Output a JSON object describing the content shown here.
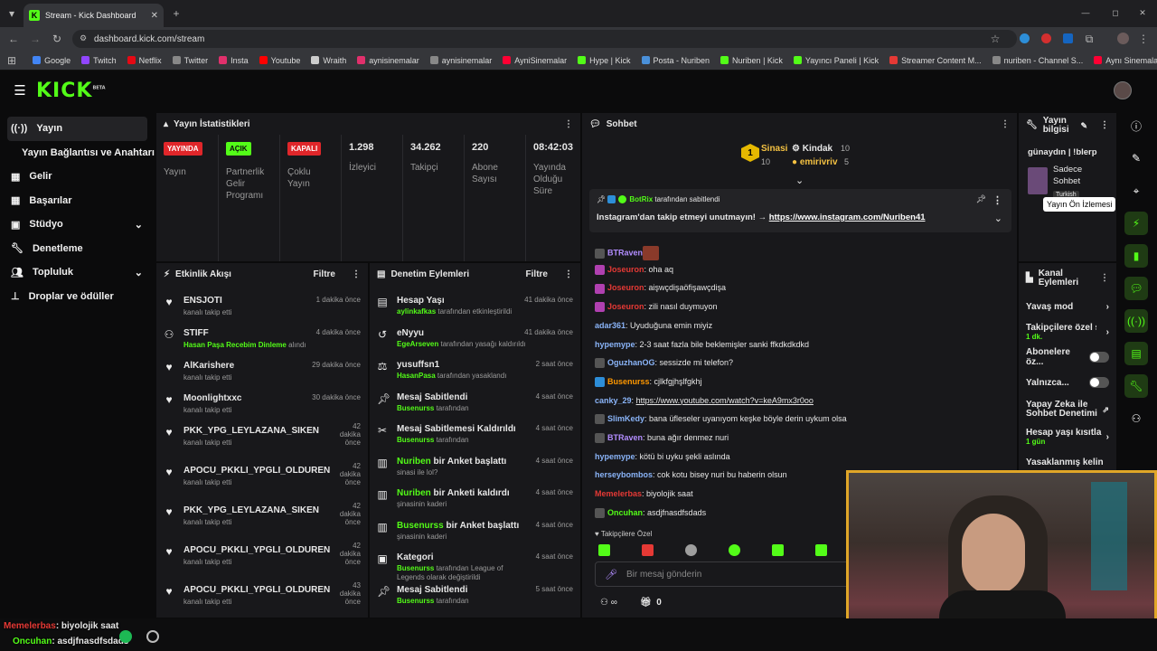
{
  "browser": {
    "tab_title": "Stream - Kick Dashboard",
    "url": "dashboard.kick.com/stream",
    "bookmarks": [
      "Google",
      "Twitch",
      "Netflix",
      "Twitter",
      "Insta",
      "Youtube",
      "Wraith",
      "aynisinemalar",
      "aynisinemalar",
      "AyniSinemalar",
      "Hype | Kick",
      "Posta - Nuriben",
      "Nuriben | Kick",
      "Yayıncı Paneli | Kick",
      "Streamer Content M...",
      "nuriben - Channel S...",
      "Aynı Sinemalar - Ça..."
    ]
  },
  "logo": "KICK",
  "logo_sup": "BETA",
  "sidebar": {
    "items": [
      {
        "label": "Yayın"
      },
      {
        "label": "Yayın Bağlantısı ve Anahtarı"
      },
      {
        "label": "Gelir"
      },
      {
        "label": "Başarılar"
      },
      {
        "label": "Stüdyo"
      },
      {
        "label": "Denetleme"
      },
      {
        "label": "Topluluk"
      },
      {
        "label": "Droplar ve ödüller"
      }
    ]
  },
  "stats": {
    "title": "Yayın İstatistikleri",
    "cards": [
      {
        "badge": "YAYINDA",
        "label": "Yayın"
      },
      {
        "badge": "AÇIK",
        "label": "Partnerlik Gelir Programı"
      },
      {
        "badge": "KAPALI",
        "label": "Çoklu Yayın"
      },
      {
        "value": "1.298",
        "label": "İzleyici"
      },
      {
        "value": "34.262",
        "label": "Takipçi"
      },
      {
        "value": "220",
        "label": "Abone Sayısı"
      },
      {
        "value": "08:42:03",
        "label": "Yayında Olduğu Süre"
      }
    ]
  },
  "activity": {
    "title": "Etkinlik Akışı",
    "filter": "Filtre",
    "items": [
      {
        "name": "ENSJOTI",
        "sub": "kanalı takip etti",
        "time": "1 dakika önce"
      },
      {
        "name": "STIFF",
        "sub_highlight": "Hasan Paşa Recebim Dinleme",
        "sub": " alındı",
        "time": "4 dakika önce"
      },
      {
        "name": "AlKarishere",
        "sub": "kanalı takip etti",
        "time": "29 dakika önce"
      },
      {
        "name": "Moonlightxxc",
        "sub": "kanalı takip etti",
        "time": "30 dakika önce"
      },
      {
        "name": "PKK_YPG_LEYLAZANA_SIKEN",
        "sub": "kanalı takip etti",
        "time": "42 dakika önce"
      },
      {
        "name": "APOCU_PKKLI_YPGLI_OLDUREN",
        "sub": "kanalı takip etti",
        "time": "42 dakika önce"
      },
      {
        "name": "PKK_YPG_LEYLAZANA_SIKEN",
        "sub": "kanalı takip etti",
        "time": "42 dakika önce"
      },
      {
        "name": "APOCU_PKKLI_YPGLI_OLDUREN",
        "sub": "kanalı takip etti",
        "time": "42 dakika önce"
      },
      {
        "name": "APOCU_PKKLI_YPGLI_OLDUREN",
        "sub": "kanalı takip etti",
        "time": "43 dakika önce"
      }
    ]
  },
  "mod": {
    "title": "Denetim Eylemleri",
    "filter": "Filtre",
    "items": [
      {
        "name": "Hesap Yaşı",
        "hl": "aylinkafkas",
        "sub": " tarafından etkinleştirildi",
        "time": "41 dakika önce"
      },
      {
        "name": "eNyyu",
        "hl": "EgeArseven",
        "sub": " tarafından yasağı kaldırıldı",
        "time": "41 dakika önce"
      },
      {
        "name": "yusuffsn1",
        "hl": "HasanPasa",
        "sub": " tarafından yasaklandı",
        "time": "2 saat önce"
      },
      {
        "name": "Mesaj Sabitlendi",
        "hl": "Busenurss",
        "sub": " tarafından",
        "time": "4 saat önce"
      },
      {
        "name": "Mesaj Sabitlemesi Kaldırıldı",
        "hl": "Busenurss",
        "sub": " tarafından",
        "time": "4 saat önce"
      },
      {
        "name_hl": "Nuriben",
        "name": " bir Anket başlattı",
        "sub": "sinasi ile lol?",
        "time": "4 saat önce"
      },
      {
        "name_hl": "Nuriben",
        "name": " bir Anketi kaldırdı",
        "sub": "şinasinin kaderi",
        "time": "4 saat önce"
      },
      {
        "name_hl": "Busenurss",
        "name": " bir Anket başlattı",
        "sub": "şinasinin kaderi",
        "time": "4 saat önce"
      },
      {
        "name": "Kategori",
        "hl": "Busenurss",
        "sub": " tarafından League of Legends olarak değiştirildi",
        "time": "4 saat önce"
      },
      {
        "name": "Mesaj Sabitlendi",
        "hl": "Busenurss",
        "sub": " tarafından",
        "time": "5 saat önce"
      }
    ]
  },
  "chat": {
    "title": "Sohbet",
    "top": [
      {
        "name": "Sinasi",
        "count": "10"
      },
      {
        "name": "Kindak",
        "count": "10"
      },
      {
        "name": "emirivriv",
        "count": "5"
      }
    ],
    "pinned_by": "BotRix",
    "pinned_suffix": " tarafından sabitlendi",
    "pinned_text": "Instagram'dan takip etmeyi unutmayın! → ",
    "pinned_link": "https://www.instagram.com/Nuriben41",
    "messages": [
      {
        "user": "BTRaven",
        "color": "#b28dff",
        "text": ""
      },
      {
        "user": "Joseuron",
        "color": "#e53935",
        "text": "oha aq"
      },
      {
        "user": "Joseuron",
        "color": "#e53935",
        "text": "aişwçdişaöfişawçdişa"
      },
      {
        "user": "Joseuron",
        "color": "#e53935",
        "text": "zili nasıl duymuyon"
      },
      {
        "user": "adar361",
        "color": "#8ab4f8",
        "text": "Uyuduğuna emin miyiz"
      },
      {
        "user": "hypemype",
        "color": "#8ab4f8",
        "text": "2-3 saat fazla bile beklemişler sanki ffkdkdkdkd"
      },
      {
        "user": "OguzhanOG",
        "color": "#8ab4f8",
        "text": "sessizde mi telefon?"
      },
      {
        "user": "Busenurss",
        "color": "#ff9800",
        "text": "cjlkfgjhşlfgkhj"
      },
      {
        "user": "canky_29",
        "color": "#8ab4f8",
        "text": "https://www.youtube.com/watch?v=keA9mx3r0oo"
      },
      {
        "user": "SlimKedy",
        "color": "#8ab4f8",
        "text": "bana üfleseler uyanıyom keşke böyle derin uykum olsa"
      },
      {
        "user": "BTRaven",
        "color": "#b28dff",
        "text": "buna ağır denmez nuri"
      },
      {
        "user": "hypemype",
        "color": "#8ab4f8",
        "text": "kötü bi uyku şekli aslında"
      },
      {
        "user": "herseybombos",
        "color": "#8ab4f8",
        "text": "cok kotu bisey nuri bu haberin olsun"
      },
      {
        "user": "Memelerbas",
        "color": "#e53935",
        "text": "biyolojik saat"
      },
      {
        "user": "Oncuhan",
        "color": "#53fc18",
        "text": "asdjfnasdfsdads"
      }
    ],
    "followers_only": "Takipçilere Özel",
    "input_placeholder": "Bir mesaj gönderin",
    "count": "0"
  },
  "stream_info": {
    "title": "Yayın bilgisi",
    "stream_title": "günaydın | !blerp",
    "category": "Sadece Sohbet",
    "language": "Turkish",
    "tooltip": "Yayın Ön İzlemesi"
  },
  "channel_actions": {
    "title": "Kanal Eylemleri",
    "items": [
      {
        "label": "Yavaş mod"
      },
      {
        "label": "Takipçilere özel s",
        "sub": "1 dk."
      },
      {
        "label": "Abonelere öz..."
      },
      {
        "label": "Yalnızca..."
      },
      {
        "label": "Yapay Zeka ile Sohbet Denetimi"
      },
      {
        "label": "Hesap yaşı kısıtla",
        "sub": "1 gün"
      },
      {
        "label": "Yasaklanmış kelin"
      }
    ]
  },
  "overlay": {
    "line1_user": "Memelerbas",
    "line1_text": "biyolojik saat",
    "line2_user": "Oncuhan",
    "line2_text": "asdjfnasdfsdads"
  }
}
